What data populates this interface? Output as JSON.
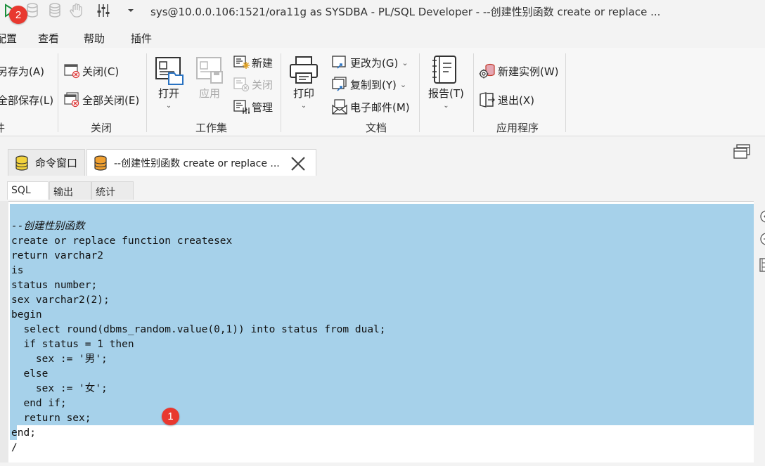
{
  "window": {
    "title": "sys@10.0.0.106:1521/ora11g as SYSDBA - PL/SQL Developer - --创建性别函数 create or replace ..."
  },
  "menubar": {
    "items": [
      "配置",
      "查看",
      "帮助",
      "插件"
    ]
  },
  "ribbon": {
    "file_group": {
      "save_as": "另存为(A)",
      "save_all": "全部保存(L)",
      "label": "件"
    },
    "close_group": {
      "close": "关闭(C)",
      "close_all": "全部关闭(E)",
      "label": "关闭"
    },
    "workset_group": {
      "open": "打开",
      "apply": "应用",
      "new": "新建",
      "close": "关闭",
      "manage": "管理",
      "label": "工作集"
    },
    "document_group": {
      "print": "打印",
      "change_to": "更改为(G)",
      "copy_to": "复制到(Y)",
      "email": "电子邮件(M)",
      "label": "文档"
    },
    "report_group": {
      "report": "报告(T)"
    },
    "application_group": {
      "new_instance": "新建实例(W)",
      "exit": "退出(X)",
      "label": "应用程序"
    }
  },
  "doc_tabs": [
    {
      "label": "命令窗口"
    },
    {
      "label": "--创建性别函数 create or replace ..."
    }
  ],
  "sub_tabs": [
    "SQL",
    "输出",
    "统计"
  ],
  "editor": {
    "lines": [
      "--创建性别函数",
      "create or replace function createsex",
      "return varchar2",
      "is",
      "status number;",
      "sex varchar2(2);",
      "begin",
      "  select round(dbms_random.value(0,1)) into status from dual;",
      "  if status = 1 then",
      "    sex := '男';",
      "  else",
      "    sex := '女';",
      "  end if;",
      "  return sex;",
      "end;",
      "/"
    ]
  },
  "badges": {
    "one": "1",
    "two": "2"
  },
  "colors": {
    "selection": "#a6d1ea",
    "badge": "#e8382f"
  }
}
